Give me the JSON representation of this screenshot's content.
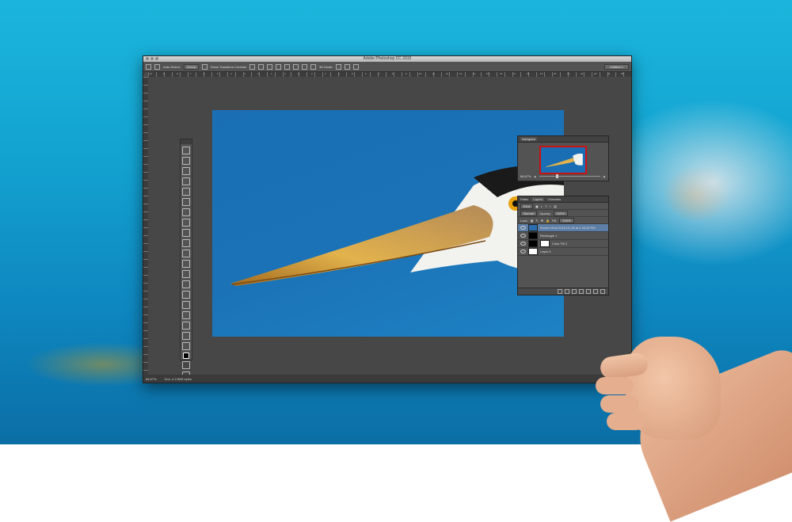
{
  "app": {
    "window_title": "Adobe Photoshop CC 2015",
    "workspace_preset": "Untitled-1"
  },
  "options_bar": {
    "auto_select_label": "Auto-Select:",
    "auto_select_value": "Group",
    "show_transform_label": "Show Transform Controls",
    "mode_3d_label": "3D Mode:"
  },
  "ruler_ticks": [
    "10",
    "9",
    "8",
    "7",
    "6",
    "5",
    "4",
    "3",
    "2",
    "1",
    "0",
    "1",
    "2",
    "3",
    "4",
    "5",
    "6",
    "7",
    "8",
    "9",
    "10",
    "11",
    "12",
    "13",
    "14",
    "15",
    "16",
    "17",
    "18",
    "19",
    "20",
    "21",
    "22",
    "23",
    "24",
    "25"
  ],
  "status": {
    "zoom": "66.67%",
    "doc_size": "Doc: 4.12M/8 bytes"
  },
  "navigator": {
    "tab_label": "Navigator",
    "zoom": "66.67%"
  },
  "layers_panel": {
    "tabs": [
      "Paths",
      "Layers",
      "Channels"
    ],
    "active_tab": "Layers",
    "kind_label": "Kind",
    "blend_mode": "Normal",
    "opacity_label": "Opacity:",
    "opacity_value": "100%",
    "lock_label": "Lock:",
    "fill_label": "Fill:",
    "fill_value": "100%",
    "layers": [
      {
        "name": "Screen Shot 2016-01-28 at 4.45.28 PM",
        "selected": true,
        "thumb": "photo"
      },
      {
        "name": "Rectangle 1",
        "selected": false,
        "thumb": "dark"
      },
      {
        "name": "Color Fill 2",
        "selected": false,
        "thumb": "mask"
      },
      {
        "name": "Layer 0",
        "selected": false,
        "thumb": "white"
      }
    ]
  },
  "colors": {
    "sky": "#13a3d1",
    "canvas_blue": "#1a6fb4",
    "ui_dark": "#535353",
    "selected_layer": "#5d7ea6",
    "nav_frame": "#d01010"
  }
}
